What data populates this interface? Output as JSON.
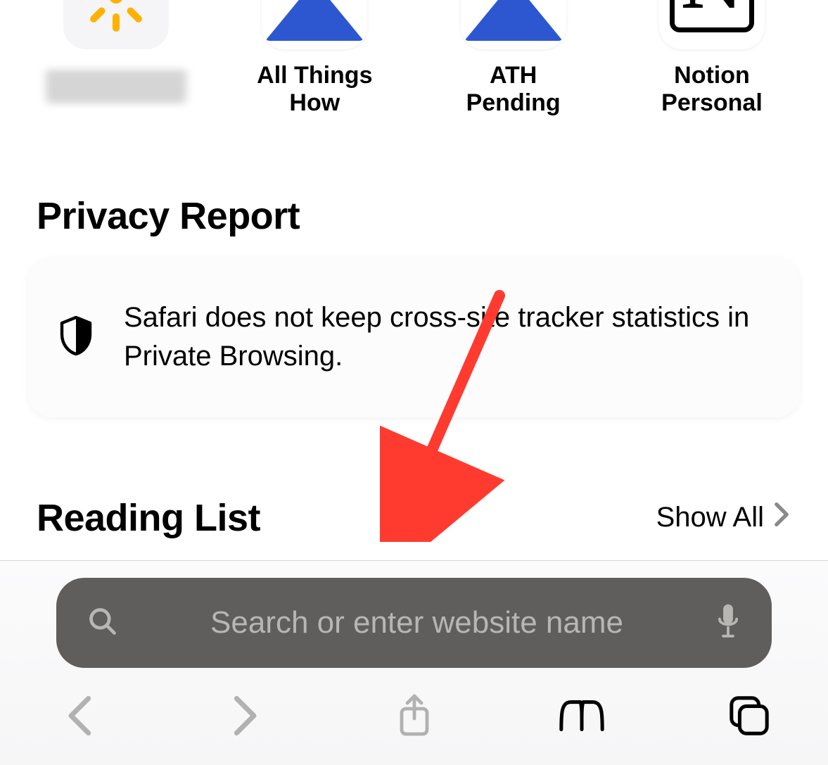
{
  "favorites": {
    "items": [
      {
        "label": "",
        "icon": "sun-icon",
        "blurred": true
      },
      {
        "label": "All Things\nHow",
        "icon": "triangle-icon"
      },
      {
        "label": "ATH\nPending",
        "icon": "triangle-icon"
      },
      {
        "label": "Notion\nPersonal",
        "icon": "notion-icon"
      }
    ]
  },
  "privacy": {
    "heading": "Privacy Report",
    "message": "Safari does not keep cross-site tracker statistics in Private Browsing."
  },
  "reading_list": {
    "heading": "Reading List",
    "show_all": "Show All"
  },
  "address_bar": {
    "placeholder": "Search or enter website name"
  },
  "annotation": {
    "arrow_color": "#ff3b30",
    "target": "address-bar"
  }
}
